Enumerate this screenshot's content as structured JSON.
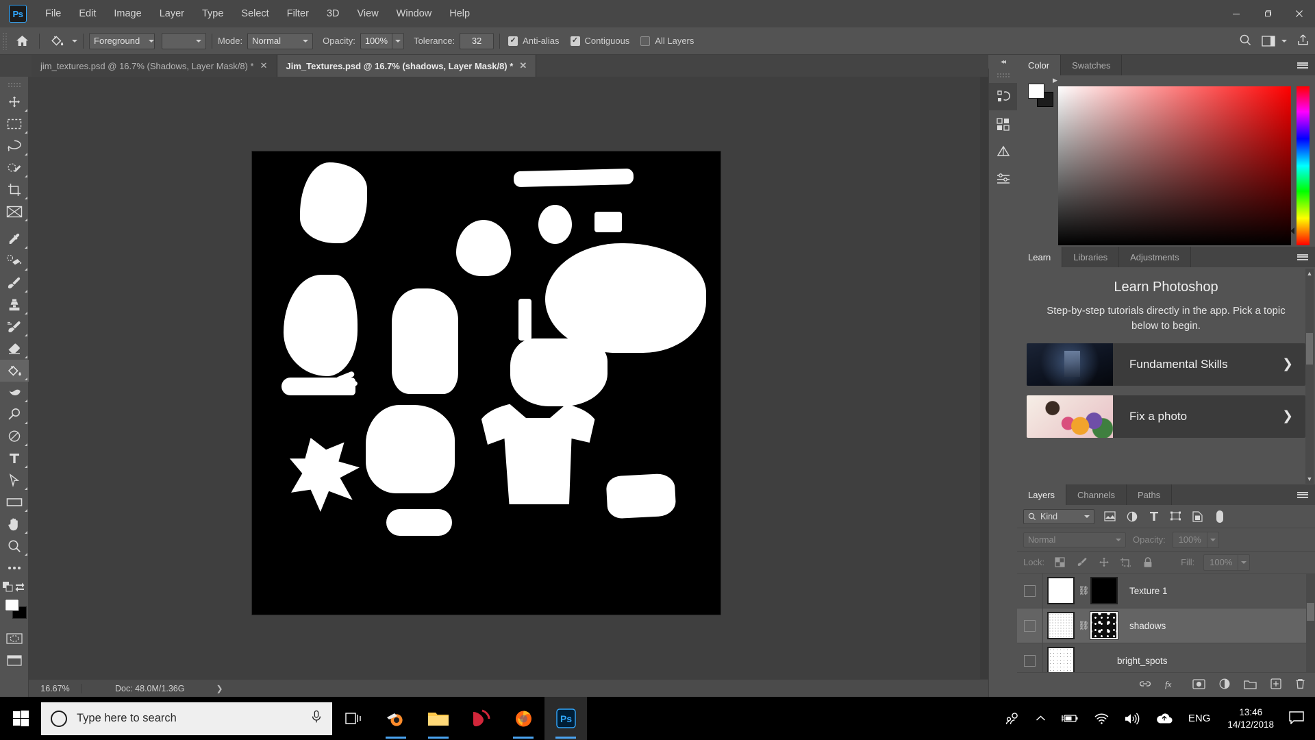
{
  "app": {
    "logo": "Ps",
    "menu": [
      "File",
      "Edit",
      "Image",
      "Layer",
      "Type",
      "Select",
      "Filter",
      "3D",
      "View",
      "Window",
      "Help"
    ],
    "window_controls": [
      "minimize-icon",
      "restore-icon",
      "close-icon"
    ]
  },
  "options_bar": {
    "tool_icon": "paint-bucket-icon",
    "home_icon": "home-icon",
    "fill_source": "Foreground",
    "mode_label": "Mode:",
    "mode_value": "Normal",
    "opacity_label": "Opacity:",
    "opacity_value": "100%",
    "tolerance_label": "Tolerance:",
    "tolerance_value": "32",
    "antialias_label": "Anti-alias",
    "antialias_checked": true,
    "contiguous_label": "Contiguous",
    "contiguous_checked": true,
    "alllayers_label": "All Layers",
    "alllayers_checked": false,
    "right_icons": [
      "search-icon",
      "workspace-icon",
      "share-icon"
    ]
  },
  "document_tabs": [
    {
      "title": "jim_textures.psd @ 16.7% (Shadows, Layer Mask/8) *",
      "close": "✕",
      "active": false
    },
    {
      "title": "Jim_Textures.psd @ 16.7% (shadows, Layer Mask/8) *",
      "close": "✕",
      "active": true
    }
  ],
  "toolbar": {
    "tools": [
      {
        "name": "move-tool",
        "icon": "move-icon",
        "selected": false
      },
      {
        "name": "rectangular-marquee-tool",
        "icon": "marquee-icon",
        "selected": false
      },
      {
        "name": "lasso-tool",
        "icon": "lasso-icon",
        "selected": false
      },
      {
        "name": "quick-selection-tool",
        "icon": "quick-select-icon",
        "selected": false
      },
      {
        "name": "crop-tool",
        "icon": "crop-icon",
        "selected": false
      },
      {
        "name": "frame-tool",
        "icon": "frame-icon",
        "selected": false
      },
      {
        "name": "eyedropper-tool",
        "icon": "eyedropper-icon",
        "selected": false
      },
      {
        "name": "spot-healing-brush-tool",
        "icon": "healing-brush-icon",
        "selected": false
      },
      {
        "name": "brush-tool",
        "icon": "brush-icon",
        "selected": false
      },
      {
        "name": "clone-stamp-tool",
        "icon": "clone-stamp-icon",
        "selected": false
      },
      {
        "name": "history-brush-tool",
        "icon": "history-brush-icon",
        "selected": false
      },
      {
        "name": "eraser-tool",
        "icon": "eraser-icon",
        "selected": false
      },
      {
        "name": "paint-bucket-tool",
        "icon": "paint-bucket-icon",
        "selected": true
      },
      {
        "name": "blur-tool",
        "icon": "blur-icon",
        "selected": false
      },
      {
        "name": "dodge-tool",
        "icon": "dodge-icon",
        "selected": false
      },
      {
        "name": "pen-tool",
        "icon": "pen-icon",
        "selected": false
      },
      {
        "name": "type-tool",
        "icon": "type-icon",
        "selected": false
      },
      {
        "name": "path-selection-tool",
        "icon": "path-arrow-icon",
        "selected": false
      },
      {
        "name": "rectangle-tool",
        "icon": "rectangle-icon",
        "selected": false
      },
      {
        "name": "hand-tool",
        "icon": "hand-icon",
        "selected": false
      },
      {
        "name": "zoom-tool",
        "icon": "magnifier-icon",
        "selected": false
      },
      {
        "name": "edit-toolbar",
        "icon": "ellipsis-icon",
        "selected": false
      }
    ],
    "foreground_color": "#ffffff",
    "background_color": "#000000",
    "quickmask_icon": "quick-mask-icon",
    "screenmode_icon": "screen-mode-icon"
  },
  "status_bar": {
    "zoom": "16.67%",
    "doc": "Doc: 48.0M/1.36G",
    "arrow": "❯"
  },
  "right_rail": {
    "items": [
      "history-icon",
      "libraries-rail-icon",
      "adjustments-rail-icon",
      "properties-rail-icon"
    ],
    "collapse": "◂◂"
  },
  "color_panel": {
    "tabs": [
      {
        "label": "Color",
        "active": true
      },
      {
        "label": "Swatches",
        "active": false
      }
    ],
    "foreground_color": "#ffffff",
    "background_color": "#1c1c1c",
    "menu_icon": "panel-menu-icon"
  },
  "learn_panel": {
    "tabs": [
      {
        "label": "Learn",
        "active": true
      },
      {
        "label": "Libraries",
        "active": false
      },
      {
        "label": "Adjustments",
        "active": false
      }
    ],
    "title": "Learn Photoshop",
    "subtitle": "Step-by-step tutorials directly in the app. Pick a topic below to begin.",
    "cards": [
      {
        "label": "Fundamental Skills",
        "thumb": "dark-room-photo",
        "chevron": "❯"
      },
      {
        "label": "Fix a photo",
        "thumb": "flowers-photo",
        "chevron": "❯"
      }
    ],
    "menu_icon": "panel-menu-icon"
  },
  "layers_panel": {
    "tabs": [
      {
        "label": "Layers",
        "active": true
      },
      {
        "label": "Channels",
        "active": false
      },
      {
        "label": "Paths",
        "active": false
      }
    ],
    "filter_label": "Kind",
    "filter_icons": [
      "pixel-filter-icon",
      "adjustment-filter-icon",
      "type-filter-icon",
      "shape-filter-icon",
      "smartobject-filter-icon"
    ],
    "filter_toggle_icon": "filter-toggle-icon",
    "blend_mode": "Normal",
    "opacity_label": "Opacity:",
    "opacity_value": "100%",
    "lock_label": "Lock:",
    "lock_icons": [
      "lock-transparency-icon",
      "lock-image-icon",
      "lock-position-icon",
      "lock-artboard-icon",
      "lock-all-icon"
    ],
    "fill_label": "Fill:",
    "fill_value": "100%",
    "layers": [
      {
        "name": "Texture 1",
        "visible": false,
        "selected": false,
        "thumb": "#ffffff",
        "mask": "#000000",
        "linked": true,
        "mask_selected": false
      },
      {
        "name": "shadows",
        "visible": false,
        "selected": true,
        "thumb": "#ffffff",
        "mask": "#111111",
        "linked": true,
        "mask_selected": true
      },
      {
        "name": "bright_spots",
        "visible": false,
        "selected": false,
        "thumb": "#ffffff",
        "mask": null,
        "linked": false,
        "mask_selected": false
      }
    ],
    "bottom_icons": [
      "link-layers-icon",
      "layer-fx-icon",
      "add-mask-icon",
      "adjustment-layer-icon",
      "new-group-icon",
      "new-layer-icon",
      "delete-layer-icon"
    ],
    "menu_icon": "panel-menu-icon"
  },
  "taskbar": {
    "start_icon": "windows-start-icon",
    "search_placeholder": "Type here to search",
    "search_icon": "cortana-circle-icon",
    "mic_icon": "microphone-icon",
    "taskview_icon": "task-view-icon",
    "apps": [
      {
        "name": "blender",
        "icon": "blender-icon",
        "running": true,
        "active": false
      },
      {
        "name": "file-explorer",
        "icon": "folder-icon",
        "running": true,
        "active": false
      },
      {
        "name": "media-player",
        "icon": "media-player-icon",
        "running": false,
        "active": false
      },
      {
        "name": "firefox",
        "icon": "firefox-icon",
        "running": true,
        "active": false
      },
      {
        "name": "photoshop",
        "icon": "photoshop-icon",
        "running": true,
        "active": true
      }
    ],
    "tray_icons": [
      "people-icon",
      "chevron-up-icon",
      "battery-icon",
      "wifi-icon",
      "volume-icon",
      "onedrive-icon"
    ],
    "language": "ENG",
    "time": "13:46",
    "date": "14/12/2018",
    "notification_icon": "action-center-icon"
  },
  "canvas": {
    "background": "#000000",
    "shape_color": "#ffffff"
  }
}
